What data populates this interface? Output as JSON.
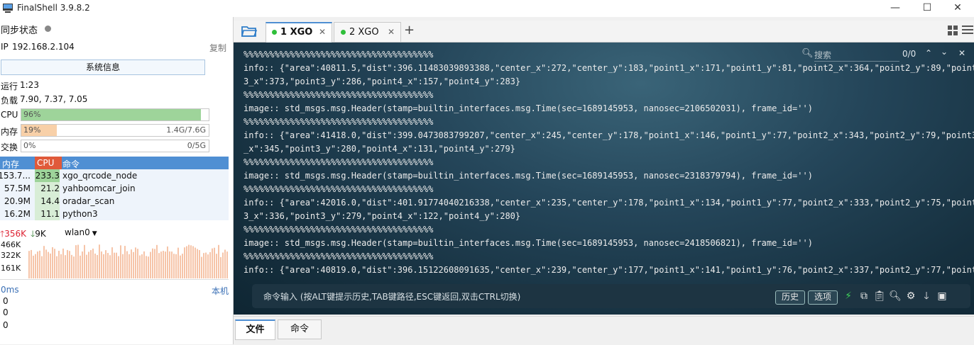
{
  "window": {
    "title": "FinalShell 3.9.8.2",
    "minimize": "—",
    "maximize": "☐",
    "close": "✕"
  },
  "left": {
    "sync_label": "同步状态",
    "ip_label": "IP",
    "ip_value": "192.168.2.104",
    "copy_label": "复制",
    "sysinfo_button": "系统信息",
    "uptime_label": "运行",
    "uptime_value": "1:23",
    "load_label": "负载",
    "load_value": "7.90, 7.37, 7.05",
    "cpu": {
      "label": "CPU",
      "percent_text": "96%",
      "fraction": 0.96
    },
    "mem": {
      "label": "内存",
      "percent_text": "19%",
      "fraction": 0.19,
      "detail": "1.4G/7.6G"
    },
    "swap": {
      "label": "交换",
      "percent_text": "0%",
      "fraction": 0.0,
      "detail": "0/5G"
    },
    "proc_headers": {
      "mem": "内存",
      "cpu": "CPU",
      "cmd": "命令"
    },
    "processes": [
      {
        "mem": "153.7...",
        "cpu": "233.3",
        "cmd": "xgo_qrcode_node"
      },
      {
        "mem": "57.5M",
        "cpu": "21.2",
        "cmd": "yahboomcar_join"
      },
      {
        "mem": "20.9M",
        "cpu": "14.4",
        "cmd": "oradar_scan"
      },
      {
        "mem": "16.2M",
        "cpu": "11.1",
        "cmd": "python3"
      }
    ],
    "net": {
      "up": "356K",
      "down": "9K",
      "iface": "wlan0",
      "ticks": [
        "466K",
        "322K",
        "161K"
      ]
    },
    "ping": {
      "latency": "0ms",
      "target": "本机",
      "values": [
        "0",
        "0",
        "0"
      ]
    }
  },
  "tabs": [
    {
      "label": "1 XGO",
      "active": true
    },
    {
      "label": "2 XGO",
      "active": false
    }
  ],
  "add_tab": "+",
  "search": {
    "placeholder": "搜索",
    "count": "0/0"
  },
  "terminal_lines": [
    "%%%%%%%%%%%%%%%%%%%%%%%%%%%%%%%%%%%%%",
    "info:: {\"area\":40811.5,\"dist\":396.11483039893388,\"center_x\":272,\"center_y\":183,\"point1_x\":171,\"point1_y\":81,\"point2_x\":364,\"point2_y\":89,\"point",
    "3_x\":373,\"point3_y\":286,\"point4_x\":157,\"point4_y\":283}",
    "%%%%%%%%%%%%%%%%%%%%%%%%%%%%%%%%%%%%%",
    "image:: std_msgs.msg.Header(stamp=builtin_interfaces.msg.Time(sec=1689145953, nanosec=2106502031), frame_id='')",
    "%%%%%%%%%%%%%%%%%%%%%%%%%%%%%%%%%%%%%",
    "info:: {\"area\":41418.0,\"dist\":399.0473083799207,\"center_x\":245,\"center_y\":178,\"point1_x\":146,\"point1_y\":77,\"point2_x\":343,\"point2_y\":79,\"point3",
    "_x\":345,\"point3_y\":280,\"point4_x\":131,\"point4_y\":279}",
    "%%%%%%%%%%%%%%%%%%%%%%%%%%%%%%%%%%%%%",
    "image:: std_msgs.msg.Header(stamp=builtin_interfaces.msg.Time(sec=1689145953, nanosec=2318379794), frame_id='')",
    "%%%%%%%%%%%%%%%%%%%%%%%%%%%%%%%%%%%%%",
    "info:: {\"area\":42016.0,\"dist\":401.91774040216338,\"center_x\":235,\"center_y\":178,\"point1_x\":134,\"point1_y\":77,\"point2_x\":333,\"point2_y\":75,\"point",
    "3_x\":336,\"point3_y\":279,\"point4_x\":122,\"point4_y\":280}",
    "%%%%%%%%%%%%%%%%%%%%%%%%%%%%%%%%%%%%%",
    "image:: std_msgs.msg.Header(stamp=builtin_interfaces.msg.Time(sec=1689145953, nanosec=2418506821), frame_id='')",
    "%%%%%%%%%%%%%%%%%%%%%%%%%%%%%%%%%%%%%",
    "info:: {\"area\":40819.0,\"dist\":396.15122608091635,\"center_x\":239,\"center_y\":177,\"point1_x\":141,\"point1_y\":76,\"point2_x\":337,\"point2_y\":77,\"point"
  ],
  "cmd": {
    "placeholder": "命令输入 (按ALT键提示历史,TAB键路径,ESC键返回,双击CTRL切换)",
    "history": "历史",
    "options": "选项"
  },
  "bottom_tabs": [
    "文件",
    "命令"
  ],
  "colors": {
    "accent": "#4f8fd3",
    "cpu_bar": "#9ed49a",
    "mem_bar": "#f8d0a8",
    "terminal_bg": "#1f3c4d",
    "tab_dot": "#2fbf3a"
  }
}
